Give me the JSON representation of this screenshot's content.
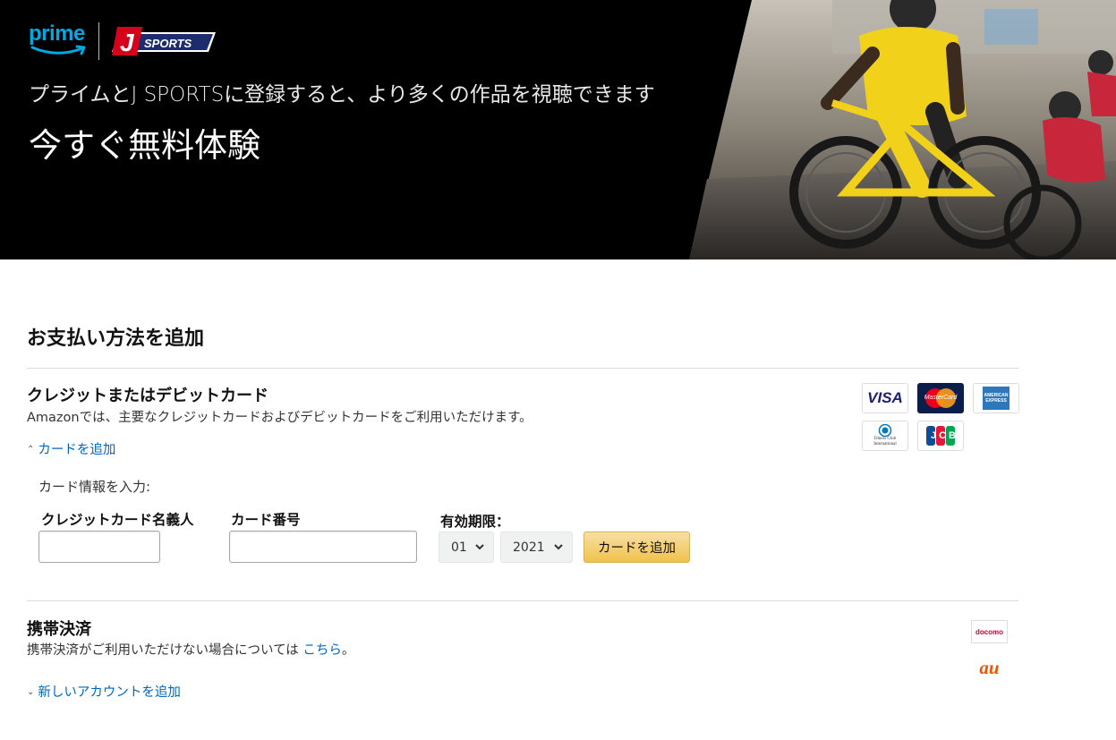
{
  "hero": {
    "prime_logo": "prime",
    "jsports_logo": "J SPORTS",
    "subtitle": "プライムとJ SPORTSに登録すると、より多くの作品を視聴できます",
    "title": "今すぐ無料体験",
    "photo_icon": "cyclist-photo"
  },
  "payment": {
    "title": "お支払い方法を追加",
    "card_section": {
      "heading": "クレジットまたはデビットカード",
      "description": "Amazonでは、主要なクレジットカードおよびデビットカードをご利用いただけます。",
      "add_card_link": "カードを追加",
      "logos": {
        "visa": "VISA",
        "mastercard": "MasterCard",
        "amex": "AMERICAN EXPRESS",
        "diners": "Diners Club International",
        "jcb": "JCB"
      },
      "form": {
        "intro": "カード情報を入力:",
        "name_label": "クレジットカード名義人",
        "name_value": "",
        "number_label": "カード番号",
        "number_value": "",
        "expiry_label": "有効期限：",
        "month_value": "01",
        "year_value": "2021",
        "submit_label": "カードを追加"
      }
    },
    "mobile_section": {
      "heading": "携帯決済",
      "description_prefix": "携帯決済がご利用いただけない場合については",
      "description_link": "こちら",
      "description_suffix": "。",
      "add_account_link": "新しいアカウントを追加",
      "carriers": {
        "docomo": "docomo",
        "au": "au"
      }
    }
  },
  "colors": {
    "link": "#0066c0",
    "prime_blue": "#00a8e1",
    "button_yellow": "#f0c14b",
    "jsports_red": "#d7001a",
    "jsports_navy": "#1d2d6b"
  }
}
